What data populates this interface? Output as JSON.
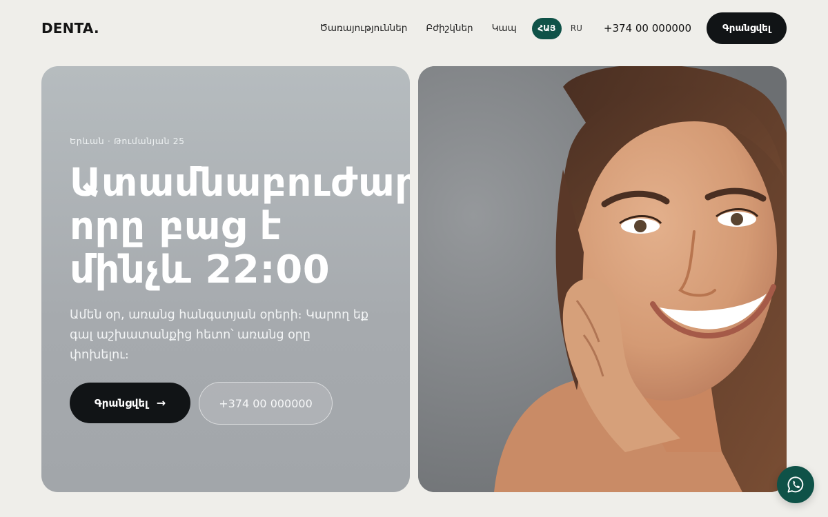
{
  "header": {
    "logo": "DENTA.",
    "nav": [
      "Ծառայություններ",
      "Բժիշկներ",
      "Կապ"
    ],
    "lang_active": "ՀԱՅ",
    "lang_other": "RU",
    "phone": "+374 00 000000",
    "cta": "Գրանցվել"
  },
  "hero": {
    "kicker": "Երևան · Թումանյան 25",
    "headline_lines": [
      "Ատամնաբուժարան,",
      "որը բաց է",
      "մինչև 22:00"
    ],
    "subtitle": "Ամեն օր, առանց հանգստյան օրերի։ Կարող եք գալ աշխատանքից հետո՝ առանց օրը փոխելու։",
    "primary_button": "Գրանցվել",
    "primary_button_arrow": "→",
    "secondary_button": "+374 00 000000"
  },
  "icons": {
    "chat": "whatsapp-icon",
    "arrow": "arrow-right-icon"
  },
  "colors": {
    "accent": "#0f5248",
    "dark": "#111416",
    "background": "#efeeea"
  }
}
